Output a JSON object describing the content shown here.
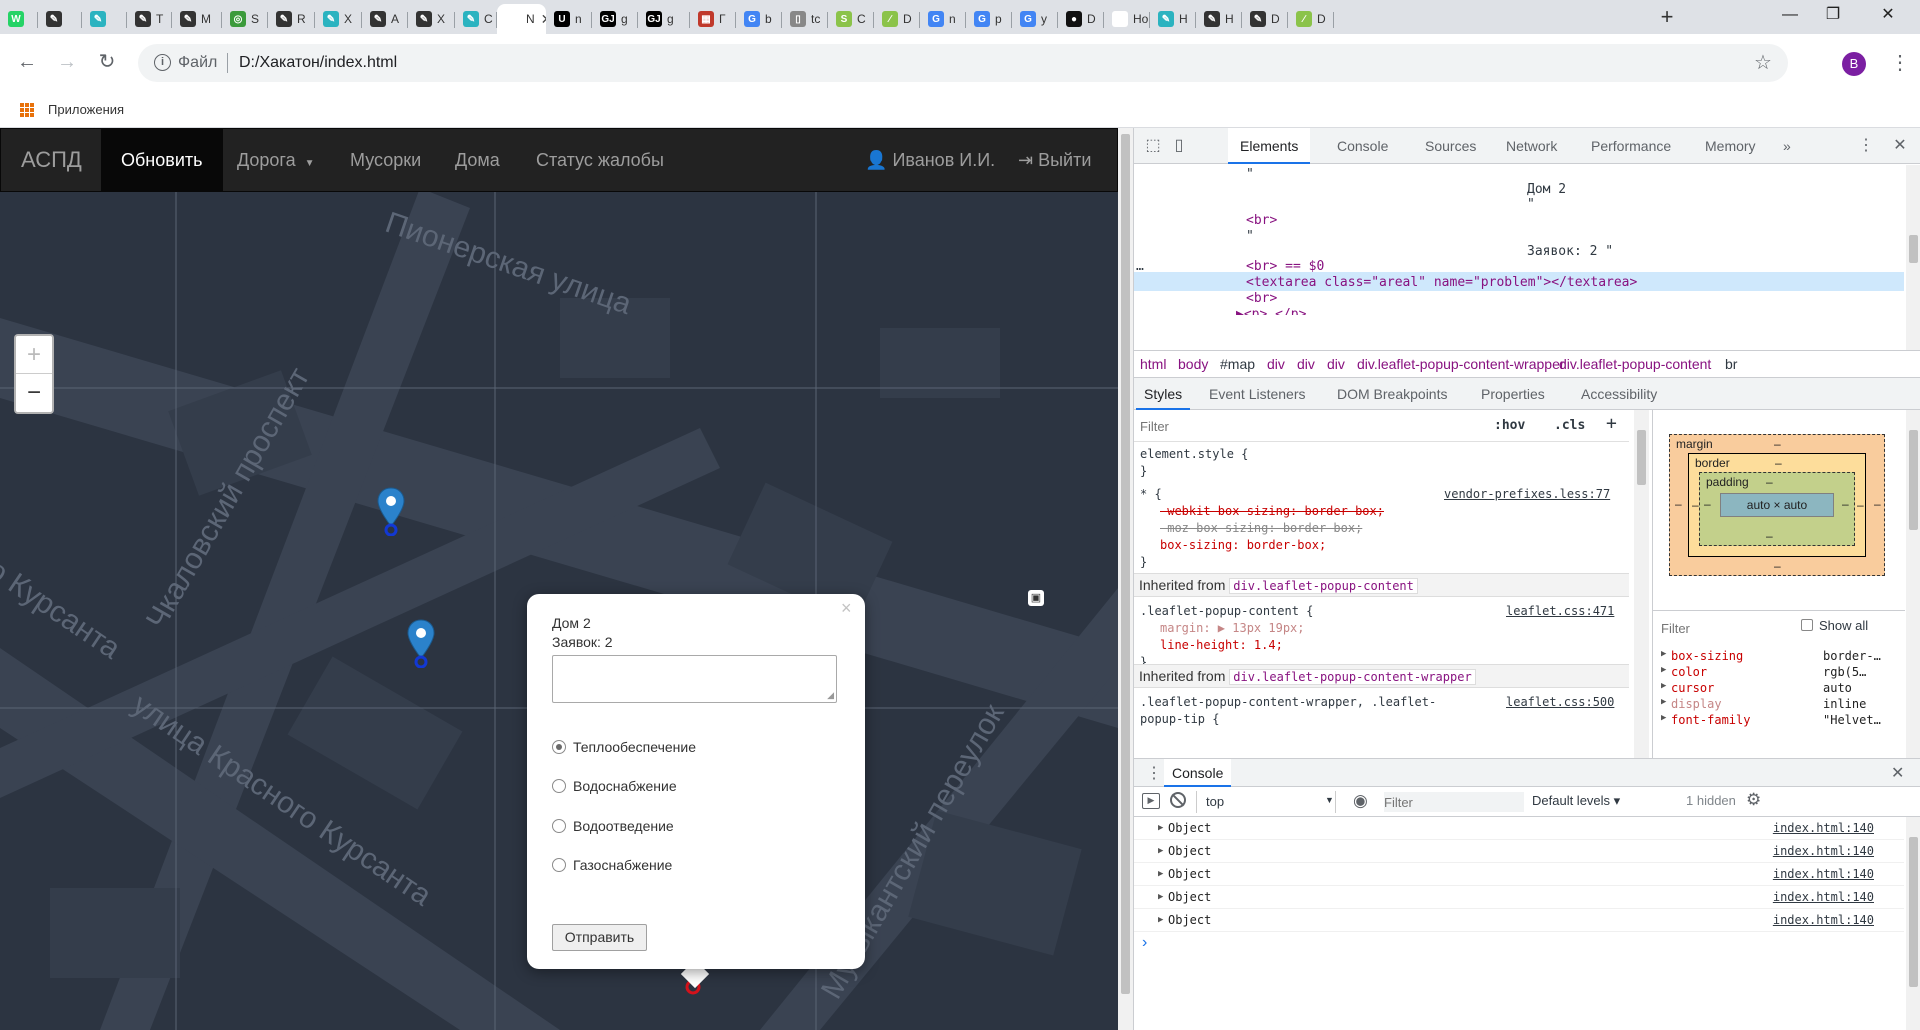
{
  "browser": {
    "tabs": [
      {
        "label": "",
        "color": "#25d366",
        "glyph": "W"
      },
      {
        "label": "",
        "color": "#333",
        "glyph": "✎"
      },
      {
        "label": "",
        "color": "#2bb3c0",
        "glyph": "✎"
      },
      {
        "label": "T",
        "color": "#333",
        "glyph": "✎"
      },
      {
        "label": "M",
        "color": "#333",
        "glyph": "✎"
      },
      {
        "label": "S",
        "color": "#3c9b3c",
        "glyph": "◎"
      },
      {
        "label": "R",
        "color": "#333",
        "glyph": "✎"
      },
      {
        "label": "X",
        "color": "#2bb3c0",
        "glyph": "✎"
      },
      {
        "label": "A",
        "color": "#333",
        "glyph": "✎"
      },
      {
        "label": "X",
        "color": "#333",
        "glyph": "✎"
      },
      {
        "label": "C",
        "color": "#2bb3c0",
        "glyph": "✎"
      },
      {
        "label": "N",
        "color": "#fff",
        "glyph": "",
        "active": true
      },
      {
        "label": "n",
        "color": "#000",
        "glyph": "U"
      },
      {
        "label": "g",
        "color": "#000",
        "glyph": "GJ"
      },
      {
        "label": "g",
        "color": "#000",
        "glyph": "GJ"
      },
      {
        "label": "Г",
        "color": "#c0392b",
        "glyph": "▦"
      },
      {
        "label": "b",
        "color": "#4285f4",
        "glyph": "G"
      },
      {
        "label": "tc",
        "color": "#888",
        "glyph": "▯"
      },
      {
        "label": "C",
        "color": "#8bc34a",
        "glyph": "S"
      },
      {
        "label": "D",
        "color": "#8bc34a",
        "glyph": "∕"
      },
      {
        "label": "n",
        "color": "#4285f4",
        "glyph": "G"
      },
      {
        "label": "p",
        "color": "#4285f4",
        "glyph": "G"
      },
      {
        "label": "y",
        "color": "#4285f4",
        "glyph": "G"
      },
      {
        "label": "D",
        "color": "#111",
        "glyph": "●"
      },
      {
        "label": "Нова",
        "color": "#fff",
        "glyph": ""
      },
      {
        "label": "H",
        "color": "#2bb3c0",
        "glyph": "✎"
      },
      {
        "label": "H",
        "color": "#333",
        "glyph": "✎"
      },
      {
        "label": "D",
        "color": "#333",
        "glyph": "✎"
      },
      {
        "label": "D",
        "color": "#8bc34a",
        "glyph": "∕"
      }
    ],
    "new_tab": "+",
    "window_controls": {
      "minimize": "—",
      "maximize": "❐",
      "close": "✕"
    },
    "address": {
      "info": "i",
      "scheme": "Файл",
      "url": "D:/Хакатон/index.html"
    },
    "profile_initial": "B",
    "bookmarks": {
      "apps_label": "Приложения"
    }
  },
  "app": {
    "brand": "АСПД",
    "nav": {
      "refresh": "Обновить",
      "road": "Дорога",
      "trash": "Мусорки",
      "houses": "Дома",
      "status": "Статус жалобы",
      "user": "Иванов И.И.",
      "logout": "Выйти"
    },
    "map": {
      "streets": [
        "Пионерская улица",
        "Чкаловский проспект",
        "улица Красного Курсанта",
        "о Курсанта",
        "Музыкантский переулок"
      ],
      "zoom_in": "+",
      "zoom_out": "−"
    },
    "popup": {
      "close": "×",
      "title": "Дом 2",
      "count": "Заявок: 2",
      "options": [
        "Теплообеспечение",
        "Водоснабжение",
        "Водоотведение",
        "Газоснабжение"
      ],
      "selected_index": 0,
      "submit": "Отправить"
    }
  },
  "devtools": {
    "tabs": [
      "Elements",
      "Console",
      "Sources",
      "Network",
      "Performance",
      "Memory"
    ],
    "more": "»",
    "dom_lines": [
      {
        "text": "\"",
        "kind": "txt"
      },
      {
        "text": "Дом 2",
        "kind": "txt"
      },
      {
        "text": "\"",
        "kind": "txt"
      },
      {
        "text": "<br>",
        "kind": "tag"
      },
      {
        "text": "\"",
        "kind": "txt"
      },
      {
        "text": "Заявок: 2 \"",
        "kind": "txt"
      },
      {
        "text": "<br> == $0",
        "kind": "tag"
      },
      {
        "text": "<textarea class=\"areal\" name=\"problem\"></textarea>",
        "kind": "tag"
      },
      {
        "text": "<br>",
        "kind": "tag"
      },
      {
        "text": "▶<p>…</p>",
        "kind": "tag"
      }
    ],
    "selected_marker": "…",
    "breadcrumbs": [
      "html",
      "body",
      "#map",
      "div",
      "div",
      "div",
      "div.leaflet-popup-content-wrapper",
      "div.leaflet-popup-content",
      "br"
    ],
    "styles_tabs": [
      "Styles",
      "Event Listeners",
      "DOM Breakpoints",
      "Properties",
      "Accessibility"
    ],
    "filter_placeholder": "Filter",
    "hov": ":hov",
    "cls": ".cls",
    "rules": {
      "element_style": "element.style {",
      "close": "}",
      "star_selector": "* {",
      "star_source": "vendor-prefixes.less:77",
      "star_props": [
        "-webkit-box-sizing: border-box;",
        "-moz-box-sizing: border-box;",
        "box-sizing: border-box;"
      ],
      "inherited_1_label": "Inherited from",
      "inherited_1": "div.leaflet-popup-content",
      "popup_content_selector": ".leaflet-popup-content {",
      "popup_content_source": "leaflet.css:471",
      "popup_content_props": [
        "margin: ▶ 13px 19px;",
        "line-height: 1.4;"
      ],
      "inherited_2": "div.leaflet-popup-content-wrapper",
      "wrapper_selector": ".leaflet-popup-content-wrapper, .leaflet-",
      "wrapper_selector_2": "popup-tip {",
      "wrapper_source": "leaflet.css:500"
    },
    "box_model": {
      "margin": "margin",
      "border": "border",
      "padding": "padding",
      "content": "auto × auto",
      "dash": "–"
    },
    "computed": {
      "filter": "Filter",
      "show_all": "Show all",
      "props": [
        {
          "name": "box-sizing",
          "value": "border-…"
        },
        {
          "name": "color",
          "value": "rgb(5…"
        },
        {
          "name": "cursor",
          "value": "auto"
        },
        {
          "name": "display",
          "value": "inline"
        },
        {
          "name": "font-family",
          "value": "\"Helvet…"
        }
      ]
    },
    "console": {
      "drawer_title": "Console",
      "context": "top",
      "filter_placeholder": "Filter",
      "levels": "Default levels ▾",
      "hidden": "1 hidden",
      "messages": [
        {
          "text": "Object",
          "source": "index.html:140"
        },
        {
          "text": "Object",
          "source": "index.html:140"
        },
        {
          "text": "Object",
          "source": "index.html:140"
        },
        {
          "text": "Object",
          "source": "index.html:140"
        },
        {
          "text": "Object",
          "source": "index.html:140"
        }
      ],
      "prompt": "›"
    }
  }
}
